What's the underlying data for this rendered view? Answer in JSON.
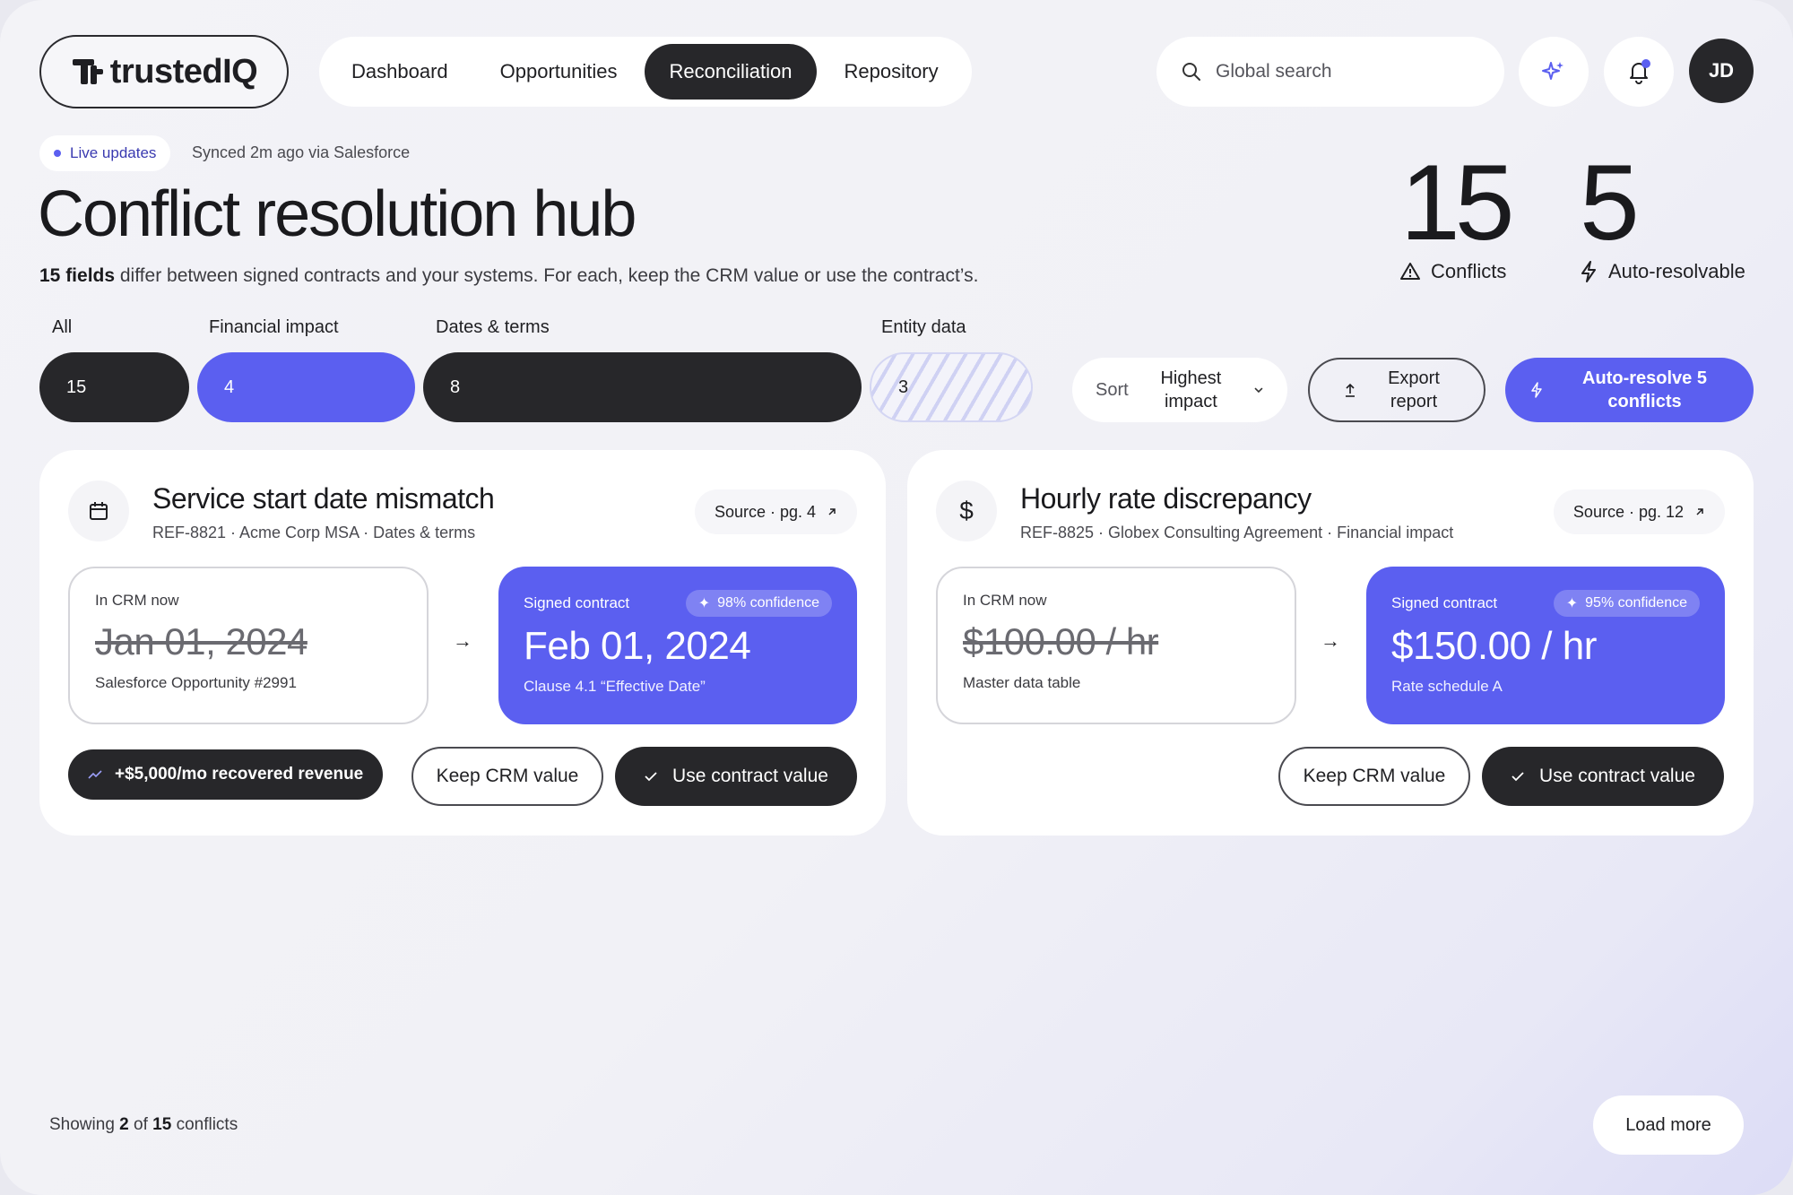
{
  "brand": {
    "name": "trustedIQ"
  },
  "nav": {
    "tabs": [
      {
        "label": "Dashboard"
      },
      {
        "label": "Opportunities"
      },
      {
        "label": "Reconciliation",
        "active": true
      },
      {
        "label": "Repository"
      }
    ]
  },
  "search": {
    "placeholder": "Global search"
  },
  "header_icons": {
    "assistant": "sparkle-icon",
    "notifications": "bell-icon",
    "has_unread": true
  },
  "user": {
    "initials": "JD"
  },
  "status": {
    "live_label": "Live updates",
    "synced_text": "Synced 2m ago via Salesforce"
  },
  "page": {
    "title": "Conflict resolution hub",
    "subtitle_bold": "15 fields",
    "subtitle_rest": " differ between signed contracts and your systems. For each, keep the CRM value or use the contract’s."
  },
  "stats": [
    {
      "value": "15",
      "label": "Conflicts",
      "icon": "warning-icon"
    },
    {
      "value": "5",
      "label": "Auto-resolvable",
      "icon": "bolt-icon"
    }
  ],
  "filters": [
    {
      "label": "All",
      "count": "15",
      "style": "dark"
    },
    {
      "label": "Financial impact",
      "count": "4",
      "style": "blue"
    },
    {
      "label": "Dates & terms",
      "count": "8",
      "style": "dark"
    },
    {
      "label": "Entity data",
      "count": "3",
      "style": "hatch"
    }
  ],
  "sort": {
    "label": "Sort",
    "value": "Highest impact"
  },
  "actions": {
    "export_label": "Export report",
    "auto_resolve_label": "Auto-resolve 5 conflicts"
  },
  "colors": {
    "accent": "#5b5ff0",
    "dark": "#27272a"
  },
  "conflicts": [
    {
      "icon": "calendar-icon",
      "title": "Service start date mismatch",
      "meta": "REF-8821 · Acme Corp MSA · Dates & terms",
      "source": "Source · pg. 4",
      "crm_label": "In CRM now",
      "crm_value": "Jan 01, 2024",
      "crm_note": "Salesforce Opportunity #2991",
      "contract_label": "Signed contract",
      "confidence": "98% confidence",
      "contract_value": "Feb 01, 2024",
      "contract_note": "Clause 4.1 “Effective Date”",
      "impact": "+$5,000/mo recovered revenue",
      "keep_label": "Keep CRM value",
      "use_label": "Use contract value"
    },
    {
      "icon": "dollar-icon",
      "title": "Hourly rate discrepancy",
      "meta": "REF-8825 · Globex Consulting Agreement · Financial impact",
      "source": "Source · pg. 12",
      "crm_label": "In CRM now",
      "crm_value": "$100.00 / hr",
      "crm_note": "Master data table",
      "contract_label": "Signed contract",
      "confidence": "95% confidence",
      "contract_value": "$150.00 / hr",
      "contract_note": "Rate schedule A",
      "impact": "",
      "keep_label": "Keep CRM value",
      "use_label": "Use contract value"
    }
  ],
  "footer": {
    "showing_prefix": "Showing ",
    "showing_count": "2",
    "showing_mid": " of ",
    "showing_total": "15",
    "showing_suffix": " conflicts",
    "load_more_label": "Load more"
  }
}
